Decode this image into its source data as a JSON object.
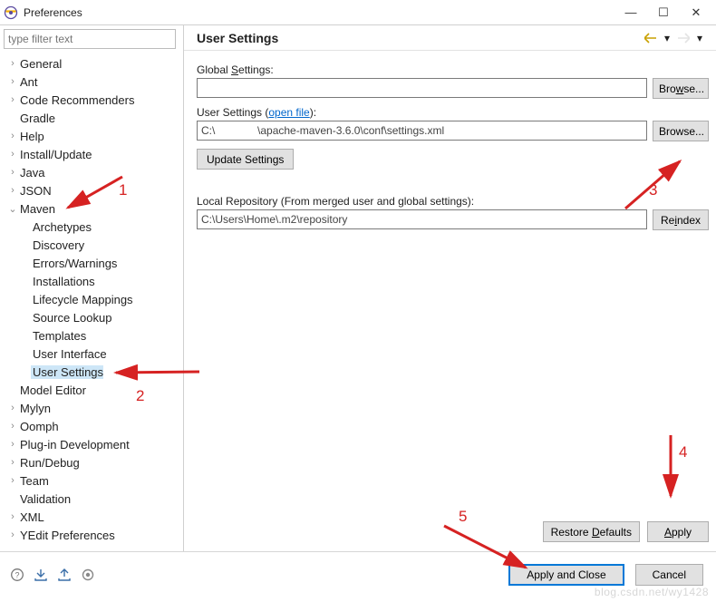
{
  "window": {
    "title": "Preferences",
    "minimize": "—",
    "maximize": "☐",
    "close": "✕"
  },
  "filter_placeholder": "type filter text",
  "tree": [
    {
      "label": "General",
      "expand": "›",
      "level": 1
    },
    {
      "label": "Ant",
      "expand": "›",
      "level": 1
    },
    {
      "label": "Code Recommenders",
      "expand": "›",
      "level": 1
    },
    {
      "label": "Gradle",
      "expand": "",
      "level": 1
    },
    {
      "label": "Help",
      "expand": "›",
      "level": 1
    },
    {
      "label": "Install/Update",
      "expand": "›",
      "level": 1
    },
    {
      "label": "Java",
      "expand": "›",
      "level": 1
    },
    {
      "label": "JSON",
      "expand": "›",
      "level": 1
    },
    {
      "label": "Maven",
      "expand": "⌄",
      "level": 1
    },
    {
      "label": "Archetypes",
      "expand": "",
      "level": 2
    },
    {
      "label": "Discovery",
      "expand": "",
      "level": 2
    },
    {
      "label": "Errors/Warnings",
      "expand": "",
      "level": 2
    },
    {
      "label": "Installations",
      "expand": "",
      "level": 2
    },
    {
      "label": "Lifecycle Mappings",
      "expand": "",
      "level": 2
    },
    {
      "label": "Source Lookup",
      "expand": "",
      "level": 2
    },
    {
      "label": "Templates",
      "expand": "",
      "level": 2
    },
    {
      "label": "User Interface",
      "expand": "",
      "level": 2
    },
    {
      "label": "User Settings",
      "expand": "",
      "level": 2,
      "selected": true
    },
    {
      "label": "Model Editor",
      "expand": "",
      "level": 1
    },
    {
      "label": "Mylyn",
      "expand": "›",
      "level": 1
    },
    {
      "label": "Oomph",
      "expand": "›",
      "level": 1
    },
    {
      "label": "Plug-in Development",
      "expand": "›",
      "level": 1
    },
    {
      "label": "Run/Debug",
      "expand": "›",
      "level": 1
    },
    {
      "label": "Team",
      "expand": "›",
      "level": 1
    },
    {
      "label": "Validation",
      "expand": "",
      "level": 1
    },
    {
      "label": "XML",
      "expand": "›",
      "level": 1
    },
    {
      "label": "YEdit Preferences",
      "expand": "›",
      "level": 1
    }
  ],
  "page": {
    "title": "User Settings",
    "global_label_pre": "Global ",
    "global_label_ul": "S",
    "global_label_post": "ettings:",
    "browse1": "Bro",
    "browse1_ul": "w",
    "browse1_post": "se...",
    "user_label_pre": "User Settings (",
    "user_label_link": "open file",
    "user_label_post": "):",
    "user_path": "C:\\              \\apache-maven-3.6.0\\conf\\settings.xml",
    "browse2": "Browse...",
    "update_btn": "Update Settings",
    "local_repo_label": "Local Repository (From merged user and global settings):",
    "local_repo_path": "C:\\Users\\Home\\.m2\\repository",
    "reindex_pre": "Re",
    "reindex_ul": "i",
    "reindex_post": "ndex",
    "restore_pre": "Restore ",
    "restore_ul": "D",
    "restore_post": "efaults",
    "apply_ul": "A",
    "apply_post": "pply"
  },
  "footer": {
    "apply_close": "Apply and Close",
    "cancel": "Cancel"
  },
  "annotations": {
    "n1": "1",
    "n2": "2",
    "n3": "3",
    "n4": "4",
    "n5": "5"
  },
  "watermark": "blog.csdn.net/wy1428"
}
